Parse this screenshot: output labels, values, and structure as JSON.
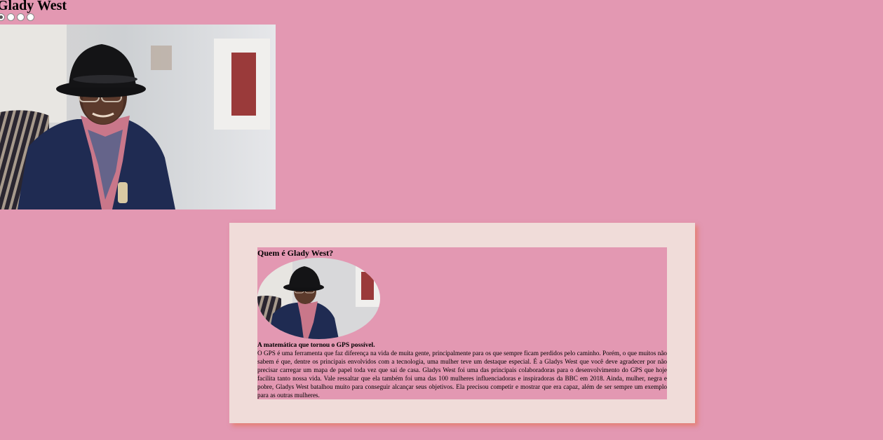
{
  "header": {
    "title": "Glady West"
  },
  "carousel": {
    "dot_count": 4,
    "active_index": 0
  },
  "card": {
    "heading": "Quem é Glady West?",
    "subheading": "A matemática que tornou o GPS possível.",
    "body": "O GPS é uma ferramenta que faz diferença na vida de muita gente, principalmente para os que sempre ficam perdidos pelo caminho. Porém, o que muitos não sabem é que, dentre os principais envolvidos com a tecnologia, uma mulher teve um destaque especial. É a Gladys West que você deve agradecer por não precisar carregar um mapa de papel toda vez que sai de casa. Gladys West foi uma das principais colaboradoras para o desenvolvimento do GPS que hoje facilita tanto nossa vida. Vale ressaltar que ela também foi uma das 100 mulheres influenciadoras e inspiradoras da BBC em 2018. Ainda, mulher, negra e pobre, Gladys West batalhou muito para conseguir alcançar seus objetivos. Ela precisou competir e mostrar que era capaz, além de ser sempre um exemplo para as outras mulheres."
  },
  "colors": {
    "page_background": "#e398b2",
    "card_background": "#f0dcd9",
    "card_shadow": "#e66e46"
  }
}
